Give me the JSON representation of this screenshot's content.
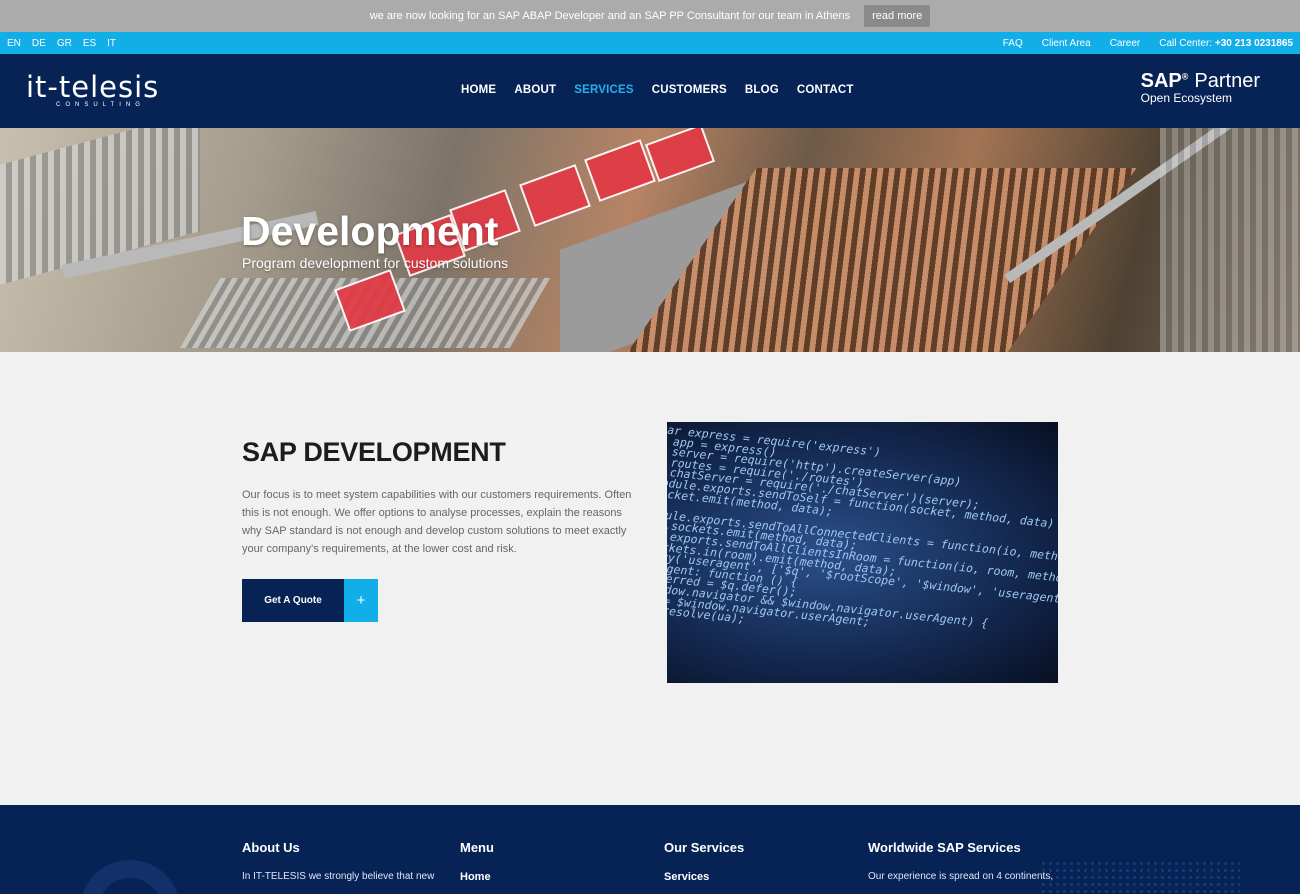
{
  "announcement": {
    "text": "we are now looking for an SAP ABAP Developer and an SAP PP Consultant for our team in Athens",
    "button": "read more"
  },
  "topbar": {
    "languages": [
      "EN",
      "DE",
      "GR",
      "ES",
      "IT"
    ],
    "links": {
      "faq": "FAQ",
      "client_area": "Client Area",
      "career": "Career",
      "call_center_label": "Call Center:",
      "call_center_number": "+30 213 0231865"
    }
  },
  "header": {
    "logo_text": "it-telesis",
    "logo_sub": "CONSULTING",
    "nav": [
      "HOME",
      "ABOUT",
      "SERVICES",
      "CUSTOMERS",
      "BLOG",
      "CONTACT"
    ],
    "active_nav": "SERVICES",
    "partner": {
      "brand": "SAP",
      "reg": "®",
      "word": "Partner",
      "sub": "Open Ecosystem"
    }
  },
  "hero": {
    "title": "Development",
    "subtitle": "Program development for custom solutions"
  },
  "main": {
    "title": "SAP DEVELOPMENT",
    "text": "Our focus is to meet system capabilities with our customers requirements. Often this is not enough. We offer options to analyse processes, explain the reasons why SAP standard is not enough and develop custom solutions to meet exactly your company's requirements, at the lower cost and risk.",
    "quote_button": "Get A Quote",
    "quote_plus": "+",
    "code_lines": [
      "           var express = require('express')",
      "       , app = express()",
      "       , server = require('http').createServer(app)",
      "       , routes = require('./routes')",
      "       , chatServer = require('./chatServer')(server);",
      "     module.exports.sendToSelf = function(socket, method, data) {",
      "       socket.emit(method, data);",
      "   }",
      "   odule.exports.sendToAllConnectedClients = function(io, method,",
      "   io.sockets.emit(method, data);",
      "",
      "   le.exports.sendToAllClientsInRoom = function(io, room, method,",
      "   sockets.in(room).emit(method, data);",
      "",
      "   tory('useragent', ['$q', '$rootScope', '$window', 'useragentmsg",
      "",
      "   erAgent: function () {",
      "   deferred = $q.defer();",
      "   window.navigator && $window.navigator.userAgent) {",
      "   ua = $window.navigator.userAgent;",
      "   ed.resolve(ua);"
    ]
  },
  "footer": {
    "about": {
      "heading": "About Us",
      "text": "In IT-TELESIS we strongly believe that new"
    },
    "menu": {
      "heading": "Menu",
      "first": "Home"
    },
    "services": {
      "heading": "Our Services",
      "first": "Services"
    },
    "worldwide": {
      "heading": "Worldwide SAP Services",
      "text": "Our experience is spread on 4 continents,"
    }
  },
  "colors": {
    "navy": "#072356",
    "accent": "#12aee8",
    "announce_bg": "#ababab"
  }
}
